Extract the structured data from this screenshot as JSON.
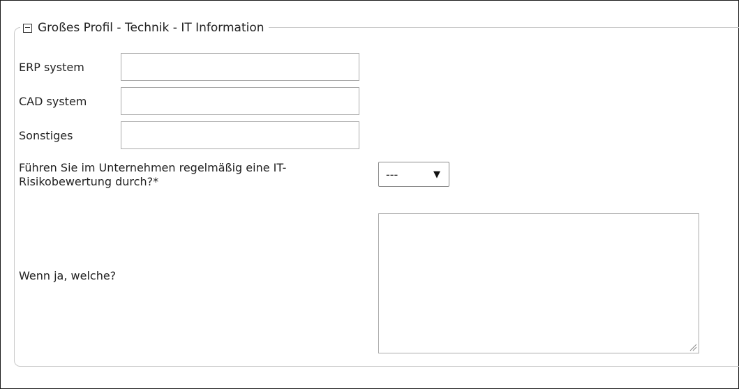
{
  "section": {
    "title": "Großes Profil - Technik - IT Information",
    "toggle_icon": "collapse-minus-icon"
  },
  "fields": {
    "erp": {
      "label": "ERP system",
      "value": ""
    },
    "cad": {
      "label": "CAD system",
      "value": ""
    },
    "other": {
      "label": "Sonstiges",
      "value": ""
    },
    "risk": {
      "label_line1": "Führen Sie im Unternehmen regelmäßig eine IT-",
      "label_line2": "Risikobewertung durch?*",
      "selected": "---",
      "caret_icon": "dropdown-triangle-icon"
    },
    "which": {
      "label": "Wenn ja, welche?",
      "value": ""
    }
  },
  "colors": {
    "border": "#c9c9c9",
    "input_border": "#a9a9a9",
    "text": "#222222"
  }
}
